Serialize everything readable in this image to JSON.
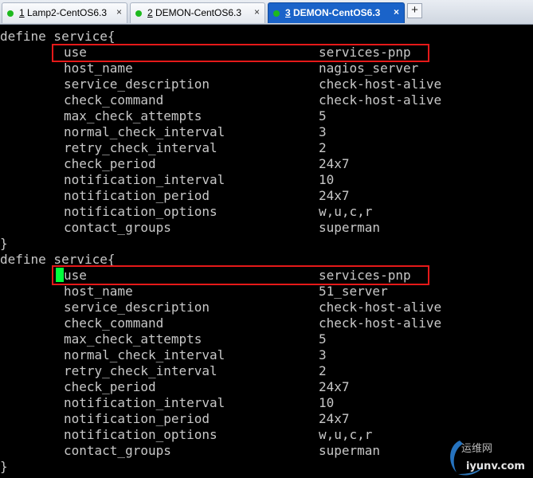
{
  "tabs": [
    {
      "number": "1",
      "title": "Lamp2-CentOS6.3",
      "close": "×",
      "active": false
    },
    {
      "number": "2",
      "title": "DEMON-CentOS6.3",
      "close": "×",
      "active": false
    },
    {
      "number": "3",
      "title": "DEMON-CentOS6.3",
      "close": "×",
      "active": true
    }
  ],
  "add_tab": "+",
  "terminal": {
    "block1": {
      "open": "define service{",
      "rows": [
        {
          "key": "use",
          "value": "services-pnp"
        },
        {
          "key": "host_name",
          "value": "nagios_server"
        },
        {
          "key": "service_description",
          "value": "check-host-alive"
        },
        {
          "key": "check_command",
          "value": "check-host-alive"
        },
        {
          "key": "max_check_attempts",
          "value": "5"
        },
        {
          "key": "normal_check_interval",
          "value": "3"
        },
        {
          "key": "retry_check_interval",
          "value": "2"
        },
        {
          "key": "check_period",
          "value": "24x7"
        },
        {
          "key": "notification_interval",
          "value": "10"
        },
        {
          "key": "notification_period",
          "value": "24x7"
        },
        {
          "key": "notification_options",
          "value": "w,u,c,r"
        },
        {
          "key": "contact_groups",
          "value": "superman"
        }
      ],
      "close": "}"
    },
    "block2": {
      "open": "define service{",
      "rows": [
        {
          "key": "use",
          "value": "services-pnp"
        },
        {
          "key": "host_name",
          "value": "51_server"
        },
        {
          "key": "service_description",
          "value": "check-host-alive"
        },
        {
          "key": "check_command",
          "value": "check-host-alive"
        },
        {
          "key": "max_check_attempts",
          "value": "5"
        },
        {
          "key": "normal_check_interval",
          "value": "3"
        },
        {
          "key": "retry_check_interval",
          "value": "2"
        },
        {
          "key": "check_period",
          "value": "24x7"
        },
        {
          "key": "notification_interval",
          "value": "10"
        },
        {
          "key": "notification_period",
          "value": "24x7"
        },
        {
          "key": "notification_options",
          "value": "w,u,c,r"
        },
        {
          "key": "contact_groups",
          "value": "superman"
        }
      ],
      "close": "}"
    }
  },
  "watermark": {
    "cn": "运维网",
    "domain": "iyunv.com"
  },
  "colors": {
    "tab_active": "#1a63c9",
    "status_dot": "#1db91d",
    "highlight": "#e51919",
    "cursor": "#00ff3c",
    "terminal_text": "#c8c8c8"
  }
}
